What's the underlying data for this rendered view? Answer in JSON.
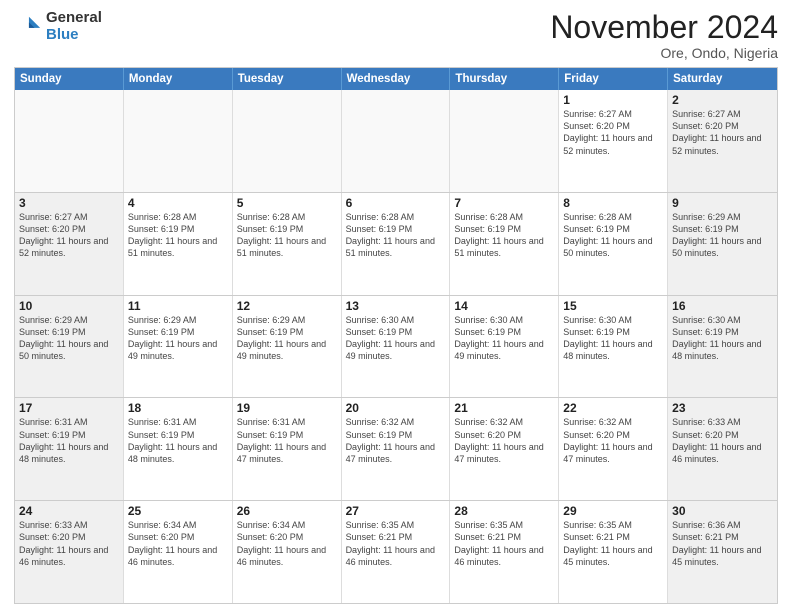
{
  "logo": {
    "general": "General",
    "blue": "Blue"
  },
  "header": {
    "month": "November 2024",
    "location": "Ore, Ondo, Nigeria"
  },
  "days": [
    "Sunday",
    "Monday",
    "Tuesday",
    "Wednesday",
    "Thursday",
    "Friday",
    "Saturday"
  ],
  "weeks": [
    [
      {
        "day": "",
        "info": ""
      },
      {
        "day": "",
        "info": ""
      },
      {
        "day": "",
        "info": ""
      },
      {
        "day": "",
        "info": ""
      },
      {
        "day": "",
        "info": ""
      },
      {
        "day": "1",
        "info": "Sunrise: 6:27 AM\nSunset: 6:20 PM\nDaylight: 11 hours and 52 minutes."
      },
      {
        "day": "2",
        "info": "Sunrise: 6:27 AM\nSunset: 6:20 PM\nDaylight: 11 hours and 52 minutes."
      }
    ],
    [
      {
        "day": "3",
        "info": "Sunrise: 6:27 AM\nSunset: 6:20 PM\nDaylight: 11 hours and 52 minutes."
      },
      {
        "day": "4",
        "info": "Sunrise: 6:28 AM\nSunset: 6:19 PM\nDaylight: 11 hours and 51 minutes."
      },
      {
        "day": "5",
        "info": "Sunrise: 6:28 AM\nSunset: 6:19 PM\nDaylight: 11 hours and 51 minutes."
      },
      {
        "day": "6",
        "info": "Sunrise: 6:28 AM\nSunset: 6:19 PM\nDaylight: 11 hours and 51 minutes."
      },
      {
        "day": "7",
        "info": "Sunrise: 6:28 AM\nSunset: 6:19 PM\nDaylight: 11 hours and 51 minutes."
      },
      {
        "day": "8",
        "info": "Sunrise: 6:28 AM\nSunset: 6:19 PM\nDaylight: 11 hours and 50 minutes."
      },
      {
        "day": "9",
        "info": "Sunrise: 6:29 AM\nSunset: 6:19 PM\nDaylight: 11 hours and 50 minutes."
      }
    ],
    [
      {
        "day": "10",
        "info": "Sunrise: 6:29 AM\nSunset: 6:19 PM\nDaylight: 11 hours and 50 minutes."
      },
      {
        "day": "11",
        "info": "Sunrise: 6:29 AM\nSunset: 6:19 PM\nDaylight: 11 hours and 49 minutes."
      },
      {
        "day": "12",
        "info": "Sunrise: 6:29 AM\nSunset: 6:19 PM\nDaylight: 11 hours and 49 minutes."
      },
      {
        "day": "13",
        "info": "Sunrise: 6:30 AM\nSunset: 6:19 PM\nDaylight: 11 hours and 49 minutes."
      },
      {
        "day": "14",
        "info": "Sunrise: 6:30 AM\nSunset: 6:19 PM\nDaylight: 11 hours and 49 minutes."
      },
      {
        "day": "15",
        "info": "Sunrise: 6:30 AM\nSunset: 6:19 PM\nDaylight: 11 hours and 48 minutes."
      },
      {
        "day": "16",
        "info": "Sunrise: 6:30 AM\nSunset: 6:19 PM\nDaylight: 11 hours and 48 minutes."
      }
    ],
    [
      {
        "day": "17",
        "info": "Sunrise: 6:31 AM\nSunset: 6:19 PM\nDaylight: 11 hours and 48 minutes."
      },
      {
        "day": "18",
        "info": "Sunrise: 6:31 AM\nSunset: 6:19 PM\nDaylight: 11 hours and 48 minutes."
      },
      {
        "day": "19",
        "info": "Sunrise: 6:31 AM\nSunset: 6:19 PM\nDaylight: 11 hours and 47 minutes."
      },
      {
        "day": "20",
        "info": "Sunrise: 6:32 AM\nSunset: 6:19 PM\nDaylight: 11 hours and 47 minutes."
      },
      {
        "day": "21",
        "info": "Sunrise: 6:32 AM\nSunset: 6:20 PM\nDaylight: 11 hours and 47 minutes."
      },
      {
        "day": "22",
        "info": "Sunrise: 6:32 AM\nSunset: 6:20 PM\nDaylight: 11 hours and 47 minutes."
      },
      {
        "day": "23",
        "info": "Sunrise: 6:33 AM\nSunset: 6:20 PM\nDaylight: 11 hours and 46 minutes."
      }
    ],
    [
      {
        "day": "24",
        "info": "Sunrise: 6:33 AM\nSunset: 6:20 PM\nDaylight: 11 hours and 46 minutes."
      },
      {
        "day": "25",
        "info": "Sunrise: 6:34 AM\nSunset: 6:20 PM\nDaylight: 11 hours and 46 minutes."
      },
      {
        "day": "26",
        "info": "Sunrise: 6:34 AM\nSunset: 6:20 PM\nDaylight: 11 hours and 46 minutes."
      },
      {
        "day": "27",
        "info": "Sunrise: 6:35 AM\nSunset: 6:21 PM\nDaylight: 11 hours and 46 minutes."
      },
      {
        "day": "28",
        "info": "Sunrise: 6:35 AM\nSunset: 6:21 PM\nDaylight: 11 hours and 46 minutes."
      },
      {
        "day": "29",
        "info": "Sunrise: 6:35 AM\nSunset: 6:21 PM\nDaylight: 11 hours and 45 minutes."
      },
      {
        "day": "30",
        "info": "Sunrise: 6:36 AM\nSunset: 6:21 PM\nDaylight: 11 hours and 45 minutes."
      }
    ]
  ]
}
